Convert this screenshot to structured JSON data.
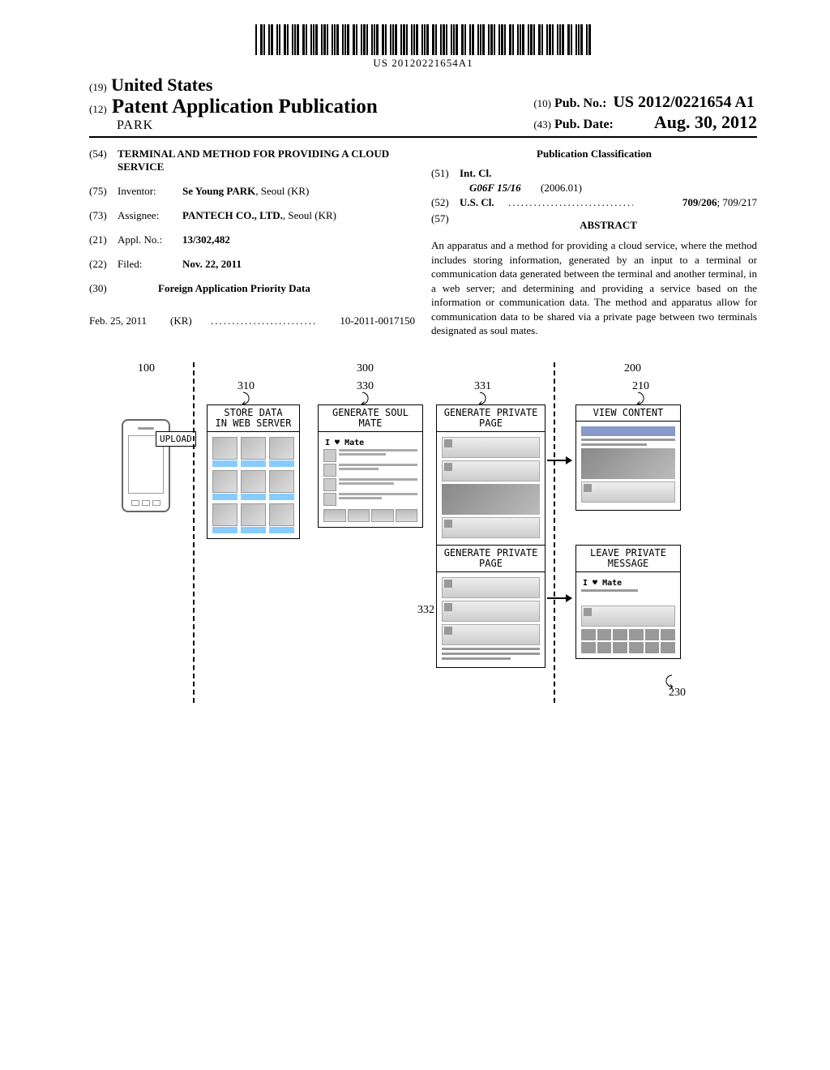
{
  "barcode_number": "US 20120221654A1",
  "header": {
    "code19": "(19)",
    "country": "United States",
    "code12": "(12)",
    "doc_type": "Patent Application Publication",
    "applicant_name": "PARK",
    "code10": "(10)",
    "pubno_label": "Pub. No.:",
    "pubno": "US 2012/0221654 A1",
    "code43": "(43)",
    "pubdate_label": "Pub. Date:",
    "pubdate": "Aug. 30, 2012"
  },
  "biblio": {
    "code54": "(54)",
    "title": "TERMINAL AND METHOD FOR PROVIDING A CLOUD SERVICE",
    "code75": "(75)",
    "inventor_label": "Inventor:",
    "inventor": "Se Young PARK",
    "inventor_loc": ", Seoul (KR)",
    "code73": "(73)",
    "assignee_label": "Assignee:",
    "assignee": "PANTECH CO., LTD.",
    "assignee_loc": ", Seoul (KR)",
    "code21": "(21)",
    "applno_label": "Appl. No.:",
    "applno": "13/302,482",
    "code22": "(22)",
    "filed_label": "Filed:",
    "filed": "Nov. 22, 2011",
    "code30": "(30)",
    "foreign_header": "Foreign Application Priority Data",
    "foreign_date": "Feb. 25, 2011",
    "foreign_country": "(KR)",
    "foreign_number": "10-2011-0017150",
    "classification_header": "Publication Classification",
    "code51": "(51)",
    "intcl_label": "Int. Cl.",
    "intcl_code": "G06F 15/16",
    "intcl_date": "(2006.01)",
    "code52": "(52)",
    "uscl_label": "U.S. Cl.",
    "uscl": "709/206; 709/217",
    "code57": "(57)",
    "abstract_header": "ABSTRACT",
    "abstract": "An apparatus and a method for providing a cloud service, where the method includes storing information, generated by an input to a terminal or communication data generated between the terminal and another terminal, in a web server; and determining and providing a service based on the information or communication data. The method and apparatus allow for communication data to be shared via a private page between two terminals designated as soul mates."
  },
  "figure": {
    "ref_100": "100",
    "ref_300": "300",
    "ref_200": "200",
    "ref_310": "310",
    "ref_330": "330",
    "ref_331": "331",
    "ref_210": "210",
    "ref_332": "332",
    "ref_230": "230",
    "upload_label": "UPLOAD",
    "box_310_title": "STORE DATA\nIN WEB SERVER",
    "box_330_title": "GENERATE SOUL MATE",
    "box_330_header": "I ♥ Mate",
    "box_331_title": "GENERATE PRIVATE PAGE",
    "box_332_title": "GENERATE PRIVATE PAGE",
    "box_210_title": "VIEW CONTENT",
    "box_230_title": "LEAVE PRIVATE MESSAGE",
    "box_230_header": "I ♥ Mate"
  }
}
